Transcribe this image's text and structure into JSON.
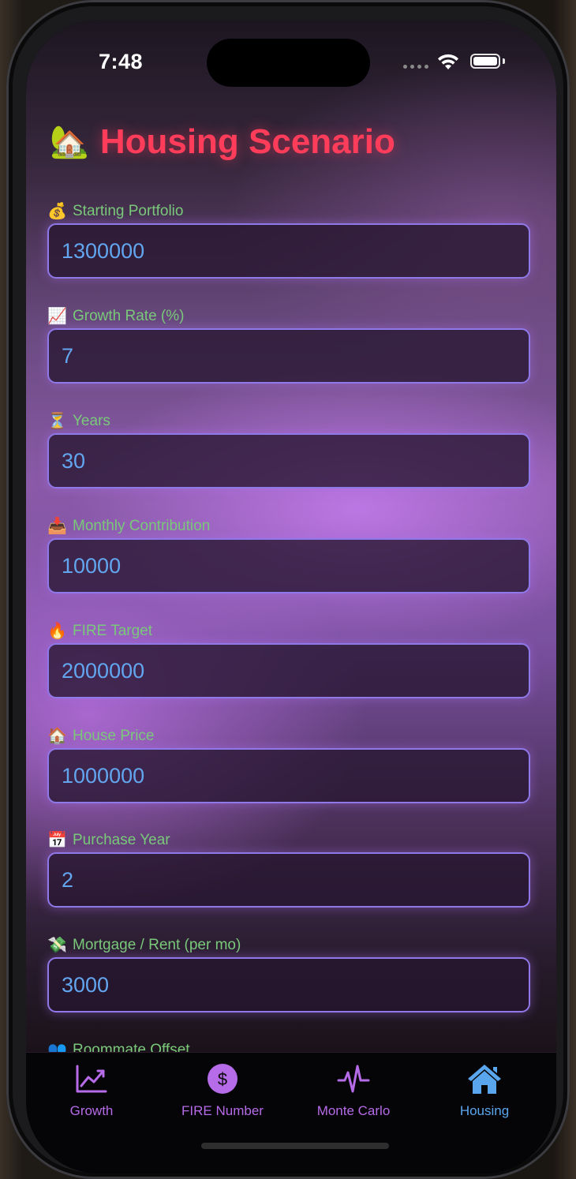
{
  "status_bar": {
    "time": "7:48"
  },
  "page": {
    "title_icon": "🏡",
    "title": "Housing Scenario"
  },
  "fields": [
    {
      "emoji": "💰",
      "label": "Starting Portfolio",
      "value": "1300000"
    },
    {
      "emoji": "📈",
      "label": "Growth Rate (%)",
      "value": "7"
    },
    {
      "emoji": "⏳",
      "label": "Years",
      "value": "30"
    },
    {
      "emoji": "📥",
      "label": "Monthly Contribution",
      "value": "10000"
    },
    {
      "emoji": "🔥",
      "label": "FIRE Target",
      "value": "2000000"
    },
    {
      "emoji": "🏠",
      "label": "House Price",
      "value": "1000000"
    },
    {
      "emoji": "📅",
      "label": "Purchase Year",
      "value": "2"
    },
    {
      "emoji": "💸",
      "label": "Mortgage / Rent (per mo)",
      "value": "3000"
    },
    {
      "emoji": "👥",
      "label": "Roommate Offset",
      "value": ""
    }
  ],
  "tabs": [
    {
      "label": "Growth",
      "icon": "chart-line-icon",
      "active": false
    },
    {
      "label": "FIRE Number",
      "icon": "dollar-circle-icon",
      "active": false
    },
    {
      "label": "Monte Carlo",
      "icon": "waveform-icon",
      "active": false
    },
    {
      "label": "Housing",
      "icon": "house-icon",
      "active": true
    }
  ],
  "colors": {
    "title": "#ff3d5a",
    "label": "#7ac97a",
    "value": "#63a6f0",
    "tab_inactive": "#b66be8",
    "tab_active": "#5aa6ee"
  }
}
